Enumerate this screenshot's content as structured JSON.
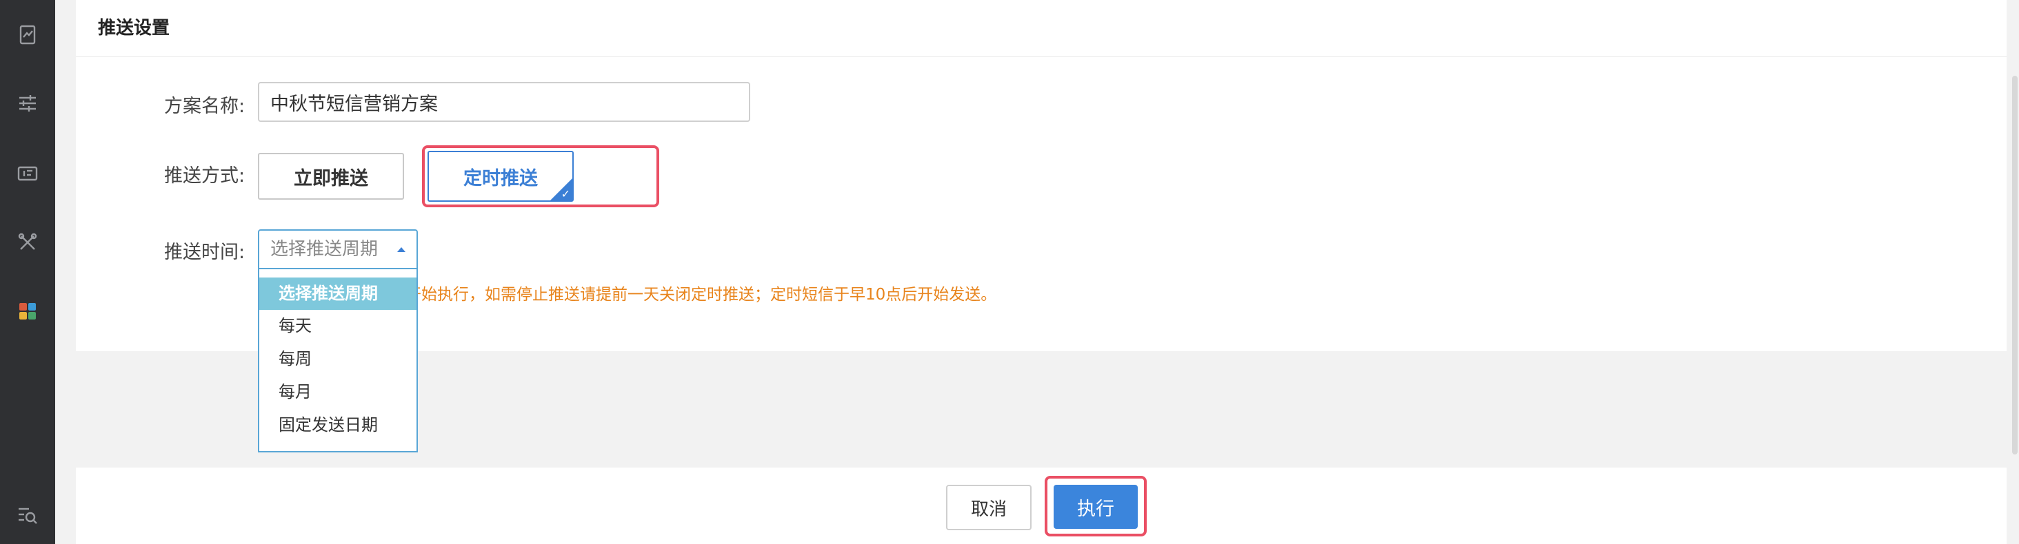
{
  "colors": {
    "sidebar": "#2f3033",
    "accent": "#3b7fd5",
    "highlight": "#ea4f64",
    "hint": "#e8841c",
    "dropdown_active": "#7ec8dc"
  },
  "sidebar": {
    "icons": [
      "report-icon",
      "sliders-icon",
      "coupon-icon",
      "tools-icon",
      "apps-icon",
      "search-list-icon"
    ]
  },
  "panel": {
    "title": "推送设置"
  },
  "form": {
    "name_label": "方案名称:",
    "name_value": "中秋节短信营销方案",
    "method_label": "推送方式:",
    "method_options": [
      "立即推送",
      "定时推送"
    ],
    "method_selected": "定时推送",
    "time_label": "推送时间:",
    "time_placeholder": "选择推送周期",
    "hint_text": "开始执行，如需停止推送请提前一天关闭定时推送；定时短信于早10点后开始发送。"
  },
  "dropdown": {
    "options": [
      "选择推送周期",
      "每天",
      "每周",
      "每月",
      "固定发送日期"
    ],
    "active_index": 0
  },
  "footer": {
    "cancel_label": "取消",
    "execute_label": "执行"
  }
}
